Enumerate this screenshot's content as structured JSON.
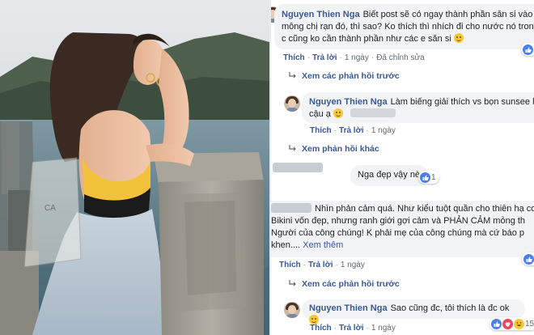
{
  "comments": [
    {
      "author": "Nguyen Thien Nga",
      "lines": [
        "Biết post sẽ có ngay thành phần săn si vào s",
        "mông chị rạn đó, thì sao? Ko thích thì nhích đi cho nước nó tron",
        "c cũng ko cần thành phần như các e săn si"
      ],
      "like": "Thích",
      "reply": "Trả lời",
      "time": "1 ngày",
      "edited": "Đã chỉnh sửa",
      "reaction_count": "1"
    },
    {
      "author": "Nguyen Thien Nga",
      "lines": [
        "Làm biếng giải thích vs bọn sunsee lắ",
        "cậu ạ"
      ],
      "like": "Thích",
      "reply": "Trả lời",
      "time": "1 ngày"
    },
    {
      "text": "Nga đẹp vậy nè",
      "reaction_count": "1"
    },
    {
      "lines": [
        "Nhìn phản cảm quá. Như kiểu tuột quần cho thiên hạ co",
        "Bikini vốn đẹp, nhưng ranh giới gợi cảm và PHẢN CẢM mỏng th",
        "Người của công chúng! K phải mẹ của công chúng mà cứ báo p",
        "khen.... "
      ],
      "see_more": "Xem thêm",
      "like": "Thích",
      "reply": "Trả lời",
      "time": "1 ngày",
      "reaction_count": "1"
    },
    {
      "author": "Nguyen Thien Nga",
      "text": "Sao cũng đc, tôi thích là đc ok",
      "like": "Thích",
      "reply": "Trả lời",
      "time": "1 ngày",
      "reaction_count": "15"
    }
  ],
  "more_replies": {
    "first": "Xem các phản hồi trước",
    "second": "Xem phản hồi khác",
    "third": "Xem các phản hồi trước"
  },
  "colors": {
    "link": "#385898",
    "bubble": "#f2f3f5",
    "meta": "#606770",
    "like": "#4b7ef5",
    "love": "#f2435f"
  }
}
